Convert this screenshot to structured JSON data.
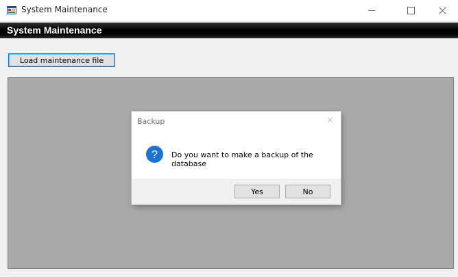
{
  "window": {
    "title": "System Maintenance",
    "controls": {
      "minimize": "minimize",
      "maximize": "maximize",
      "close": "close"
    }
  },
  "header": {
    "title": "System Maintenance"
  },
  "toolbar": {
    "load_label": "Load maintenance file"
  },
  "dialog": {
    "title": "Backup",
    "message": "Do you want to make a backup of the database",
    "icon": "question-icon",
    "yes_label": "Yes",
    "no_label": "No",
    "close_glyph": "✕"
  },
  "colors": {
    "panel": "#a9a9a9",
    "header_bar": "#000000",
    "accent": "#0078d7",
    "question_icon": "#1c73d1"
  }
}
